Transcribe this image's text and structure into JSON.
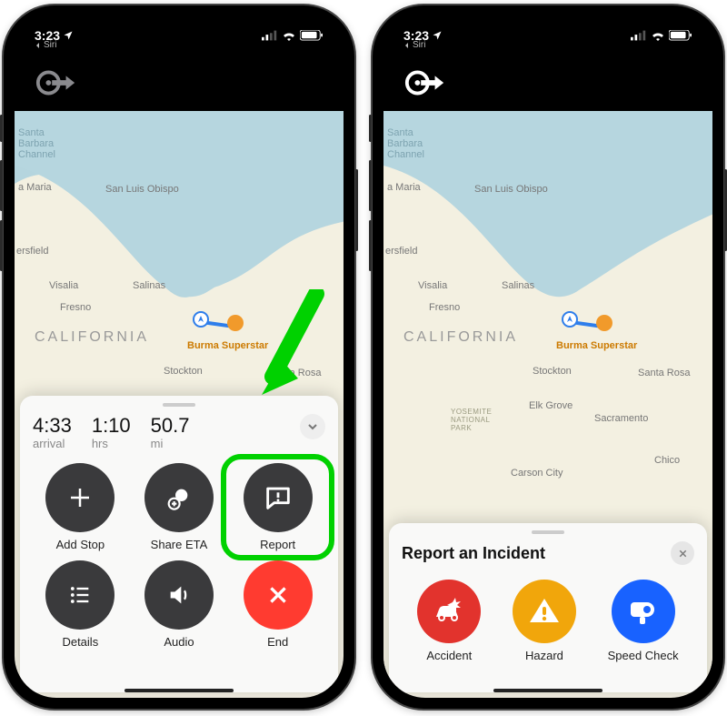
{
  "status": {
    "time": "3:23",
    "back_label": "Siri"
  },
  "nav_card": {
    "arrival_value": "4:33",
    "arrival_label": "arrival",
    "duration_value": "1:10",
    "duration_label": "hrs",
    "distance_value": "50.7",
    "distance_label": "mi",
    "actions": {
      "add_stop": "Add Stop",
      "share_eta": "Share ETA",
      "report": "Report",
      "details": "Details",
      "audio": "Audio",
      "end": "End"
    }
  },
  "report_sheet": {
    "title": "Report an Incident",
    "options": {
      "accident": "Accident",
      "hazard": "Hazard",
      "speed_check": "Speed Check"
    }
  },
  "map_places": {
    "california": "CALIFORNIA",
    "santa_barbara": "Santa\nBarbara\nChannel",
    "a_maria": "a Maria",
    "san_luis_obispo": "San Luis Obispo",
    "ersfield": "ersfield",
    "visalia": "Visalia",
    "fresno": "Fresno",
    "salinas": "Salinas",
    "burma": "Burma Superstar",
    "stockton": "Stockton",
    "santa_rosa": "Santa Rosa",
    "elk_grove": "Elk Grove",
    "sacramento": "Sacramento",
    "carson_city": "Carson City",
    "chico": "Chico",
    "yosemite": "YOSEMITE\nNATIONAL\nPARK"
  }
}
